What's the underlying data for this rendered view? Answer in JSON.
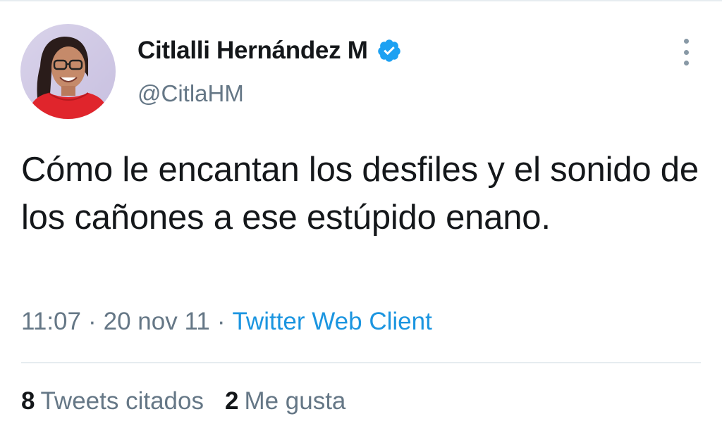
{
  "tweet": {
    "author": {
      "display_name": "Citlalli Hernández M",
      "handle": "@CitlaHM",
      "verified": true,
      "avatar_icon": "avatar-photo-icon"
    },
    "text": "Cómo le encantan los desfiles y el sonido de los cañones a ese estúpido enano.",
    "time": "11:07",
    "separator": "·",
    "date": "20 nov 11",
    "source": "Twitter Web Client",
    "stats": {
      "quote_tweets_count": "8",
      "quote_tweets_label": "Tweets citados",
      "likes_count": "2",
      "likes_label": "Me gusta"
    }
  },
  "icons": {
    "verified": "verified-badge-icon",
    "more": "more-options-icon"
  },
  "colors": {
    "text_primary": "#14171a",
    "text_secondary": "#657786",
    "link": "#1b95e0",
    "verified": "#1da1f2",
    "divider": "#e6ecf0"
  }
}
